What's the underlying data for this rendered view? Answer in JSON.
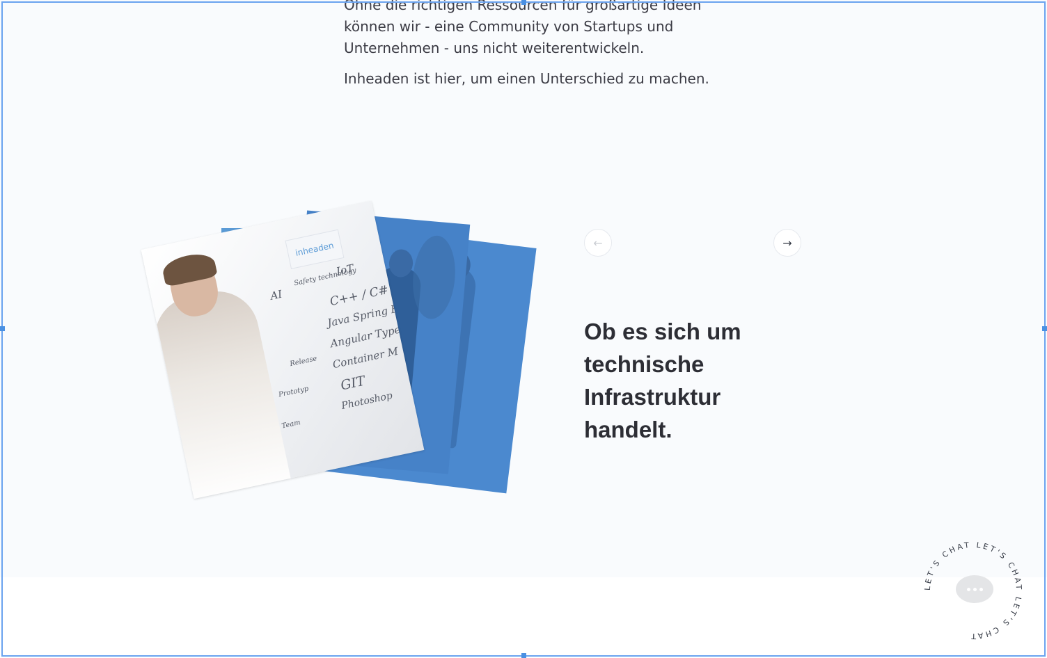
{
  "intro": {
    "paragraph1": "Ohne die richtigen Ressourcen für großartige Ideen können wir - eine Community von Startups und Unternehmen - uns nicht weiterentwickeln.",
    "paragraph2": "Inheaden ist hier, um einen Unterschied zu machen."
  },
  "slider": {
    "prev_icon": "arrow-left-icon",
    "next_icon": "arrow-right-icon",
    "prev_glyph": "←",
    "next_glyph": "→",
    "heading": "Ob es sich um technische Infrastruktur handelt."
  },
  "whiteboard": {
    "logo": "inheaden",
    "items": [
      "C++ / C#",
      "Java Spring Bo",
      "Angular Types",
      "Container M",
      "GIT",
      "Photoshop"
    ],
    "bubbles": [
      "AI",
      "Safety technology",
      "IoT"
    ],
    "timeline": [
      "Release",
      "Prototyp",
      "Team"
    ]
  },
  "chat": {
    "ring_text": "LET'S CHAT LET'S CHAT LET'S CHAT ",
    "icon": "chat-bubble-icon"
  },
  "colors": {
    "accent": "#4a90e2",
    "card_blue": "#5b9bd6",
    "text_dark": "#2d2e35"
  }
}
